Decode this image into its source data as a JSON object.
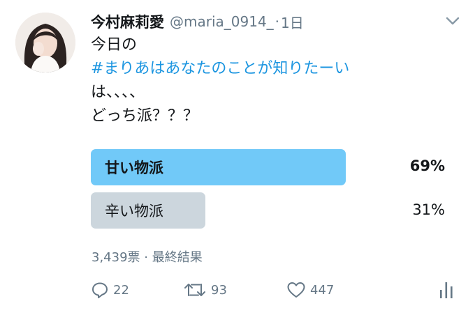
{
  "tweet": {
    "display_name": "今村麻莉愛",
    "handle": "@maria_0914_",
    "separator": "·",
    "time": "1日",
    "text_line1": "今日の",
    "hashtag": "#まりあはあなたのことが知りたーい",
    "text_line3": "は、、、、",
    "text_line4": "どっち派？？？"
  },
  "poll": {
    "options": [
      {
        "label": "甘い物派",
        "percent": "69%",
        "value": 69,
        "leading": true
      },
      {
        "label": "辛い物派",
        "percent": "31%",
        "value": 31,
        "leading": false
      }
    ],
    "meta": "3,439票 · 最終結果",
    "colors": {
      "leading": "#71c9f8",
      "other": "#ccd6dd"
    }
  },
  "actions": {
    "reply_count": "22",
    "retweet_count": "93",
    "like_count": "447",
    "icons": [
      "reply-icon",
      "retweet-icon",
      "like-icon",
      "analytics-icon"
    ]
  },
  "colors": {
    "accent": "#1b95e0",
    "secondary_text": "#657786"
  }
}
